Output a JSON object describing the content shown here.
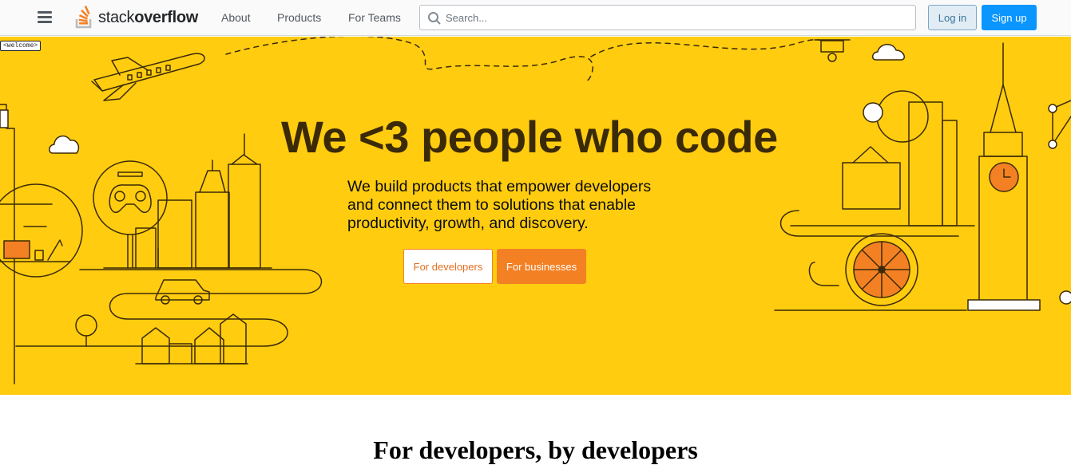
{
  "header": {
    "logo_text_light": "stack",
    "logo_text_bold": "overflow",
    "nav": [
      "About",
      "Products",
      "For Teams"
    ],
    "search_placeholder": "Search...",
    "login_label": "Log in",
    "signup_label": "Sign up",
    "icons": [
      "menu-icon",
      "stackoverflow-logo-icon",
      "search-icon"
    ]
  },
  "hero": {
    "welcome_tag": "<welcome>",
    "title": "We <3 people who code",
    "subtitle": "We build products that empower developers and connect them to solutions that enable productivity, growth, and discovery.",
    "btn_developers": "For developers",
    "btn_businesses": "For businesses",
    "background_color": "#ffcc0f",
    "illustration_icons": [
      "airplane-icon",
      "cloud-icon",
      "gamepad-icon",
      "city-skyline-icon",
      "car-icon",
      "house-icon",
      "desk-icon",
      "big-ben-icon",
      "ferris-wheel-icon",
      "sync-icon",
      "tree-icon",
      "drone-icon"
    ]
  },
  "section": {
    "heading": "For developers, by developers"
  },
  "colors": {
    "accent_orange": "#f48024",
    "primary_blue": "#0a95ff",
    "login_bg": "#e1ecf4",
    "login_text": "#39739d"
  }
}
